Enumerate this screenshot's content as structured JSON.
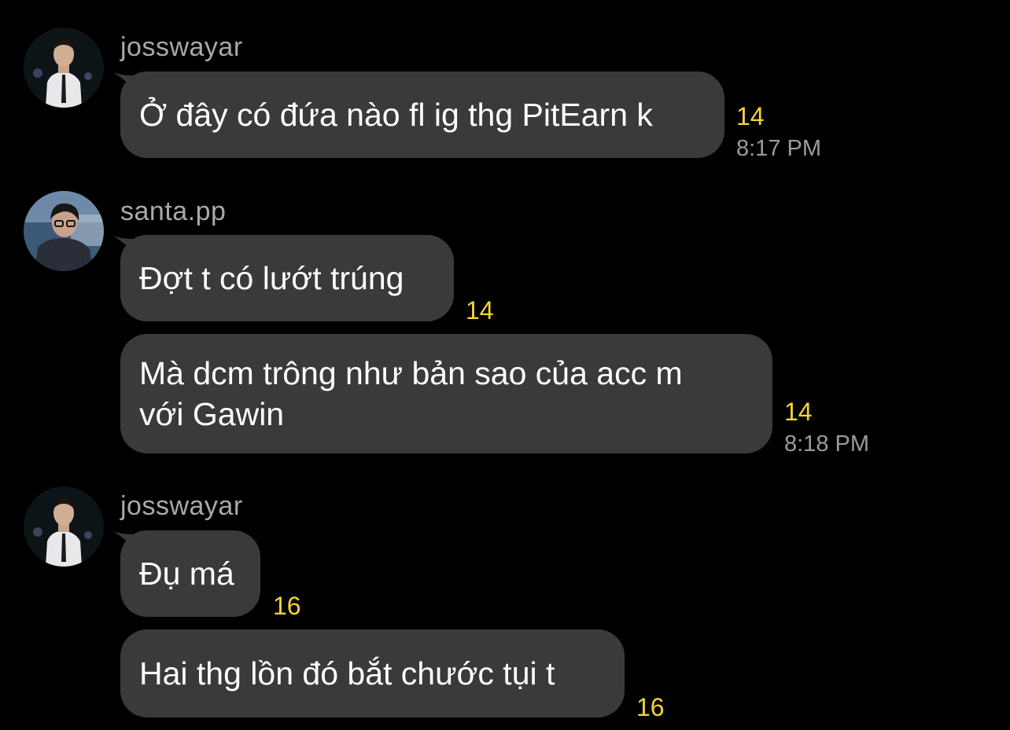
{
  "colors": {
    "background": "#000000",
    "bubble": "#3a3a3c",
    "sender_text": "#a8a8ad",
    "count_text": "#f4d434",
    "time_text": "#9a9aa0"
  },
  "messages": [
    {
      "sender": "josswayar",
      "avatar_icon": "user-avatar-icon",
      "text": "Ở đây có đứa nào fl ig thg PitEarn k",
      "count": "14",
      "time": "8:17 PM"
    },
    {
      "sender": "santa.pp",
      "avatar_icon": "user-avatar-icon",
      "text": "Đợt t có lướt trúng",
      "count": "14"
    },
    {
      "text_line1": "Mà dcm trông như bản sao của acc m",
      "text_line2": "với Gawin",
      "count": "14",
      "time": "8:18 PM"
    },
    {
      "sender": "josswayar",
      "avatar_icon": "user-avatar-icon",
      "text": "Đụ má",
      "count": "16"
    },
    {
      "text": "Hai thg lồn đó bắt chước tụi t",
      "count": "16"
    }
  ]
}
